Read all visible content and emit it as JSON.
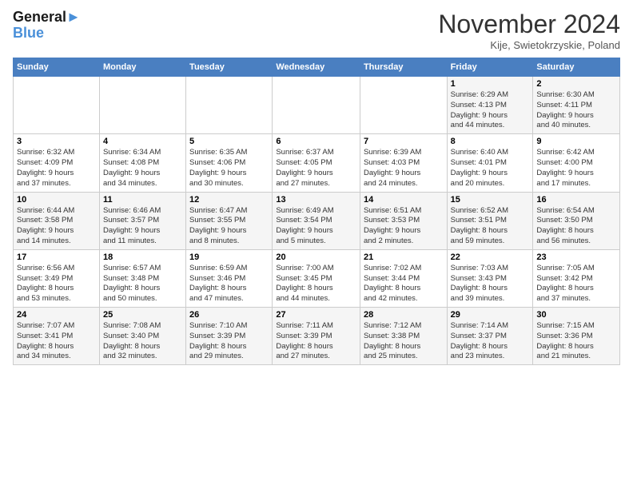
{
  "logo": {
    "line1": "General",
    "line2": "Blue"
  },
  "title": "November 2024",
  "location": "Kije, Swietokrzyskie, Poland",
  "days_of_week": [
    "Sunday",
    "Monday",
    "Tuesday",
    "Wednesday",
    "Thursday",
    "Friday",
    "Saturday"
  ],
  "weeks": [
    [
      {
        "day": "",
        "info": ""
      },
      {
        "day": "",
        "info": ""
      },
      {
        "day": "",
        "info": ""
      },
      {
        "day": "",
        "info": ""
      },
      {
        "day": "",
        "info": ""
      },
      {
        "day": "1",
        "info": "Sunrise: 6:29 AM\nSunset: 4:13 PM\nDaylight: 9 hours\nand 44 minutes."
      },
      {
        "day": "2",
        "info": "Sunrise: 6:30 AM\nSunset: 4:11 PM\nDaylight: 9 hours\nand 40 minutes."
      }
    ],
    [
      {
        "day": "3",
        "info": "Sunrise: 6:32 AM\nSunset: 4:09 PM\nDaylight: 9 hours\nand 37 minutes."
      },
      {
        "day": "4",
        "info": "Sunrise: 6:34 AM\nSunset: 4:08 PM\nDaylight: 9 hours\nand 34 minutes."
      },
      {
        "day": "5",
        "info": "Sunrise: 6:35 AM\nSunset: 4:06 PM\nDaylight: 9 hours\nand 30 minutes."
      },
      {
        "day": "6",
        "info": "Sunrise: 6:37 AM\nSunset: 4:05 PM\nDaylight: 9 hours\nand 27 minutes."
      },
      {
        "day": "7",
        "info": "Sunrise: 6:39 AM\nSunset: 4:03 PM\nDaylight: 9 hours\nand 24 minutes."
      },
      {
        "day": "8",
        "info": "Sunrise: 6:40 AM\nSunset: 4:01 PM\nDaylight: 9 hours\nand 20 minutes."
      },
      {
        "day": "9",
        "info": "Sunrise: 6:42 AM\nSunset: 4:00 PM\nDaylight: 9 hours\nand 17 minutes."
      }
    ],
    [
      {
        "day": "10",
        "info": "Sunrise: 6:44 AM\nSunset: 3:58 PM\nDaylight: 9 hours\nand 14 minutes."
      },
      {
        "day": "11",
        "info": "Sunrise: 6:46 AM\nSunset: 3:57 PM\nDaylight: 9 hours\nand 11 minutes."
      },
      {
        "day": "12",
        "info": "Sunrise: 6:47 AM\nSunset: 3:55 PM\nDaylight: 9 hours\nand 8 minutes."
      },
      {
        "day": "13",
        "info": "Sunrise: 6:49 AM\nSunset: 3:54 PM\nDaylight: 9 hours\nand 5 minutes."
      },
      {
        "day": "14",
        "info": "Sunrise: 6:51 AM\nSunset: 3:53 PM\nDaylight: 9 hours\nand 2 minutes."
      },
      {
        "day": "15",
        "info": "Sunrise: 6:52 AM\nSunset: 3:51 PM\nDaylight: 8 hours\nand 59 minutes."
      },
      {
        "day": "16",
        "info": "Sunrise: 6:54 AM\nSunset: 3:50 PM\nDaylight: 8 hours\nand 56 minutes."
      }
    ],
    [
      {
        "day": "17",
        "info": "Sunrise: 6:56 AM\nSunset: 3:49 PM\nDaylight: 8 hours\nand 53 minutes."
      },
      {
        "day": "18",
        "info": "Sunrise: 6:57 AM\nSunset: 3:48 PM\nDaylight: 8 hours\nand 50 minutes."
      },
      {
        "day": "19",
        "info": "Sunrise: 6:59 AM\nSunset: 3:46 PM\nDaylight: 8 hours\nand 47 minutes."
      },
      {
        "day": "20",
        "info": "Sunrise: 7:00 AM\nSunset: 3:45 PM\nDaylight: 8 hours\nand 44 minutes."
      },
      {
        "day": "21",
        "info": "Sunrise: 7:02 AM\nSunset: 3:44 PM\nDaylight: 8 hours\nand 42 minutes."
      },
      {
        "day": "22",
        "info": "Sunrise: 7:03 AM\nSunset: 3:43 PM\nDaylight: 8 hours\nand 39 minutes."
      },
      {
        "day": "23",
        "info": "Sunrise: 7:05 AM\nSunset: 3:42 PM\nDaylight: 8 hours\nand 37 minutes."
      }
    ],
    [
      {
        "day": "24",
        "info": "Sunrise: 7:07 AM\nSunset: 3:41 PM\nDaylight: 8 hours\nand 34 minutes."
      },
      {
        "day": "25",
        "info": "Sunrise: 7:08 AM\nSunset: 3:40 PM\nDaylight: 8 hours\nand 32 minutes."
      },
      {
        "day": "26",
        "info": "Sunrise: 7:10 AM\nSunset: 3:39 PM\nDaylight: 8 hours\nand 29 minutes."
      },
      {
        "day": "27",
        "info": "Sunrise: 7:11 AM\nSunset: 3:39 PM\nDaylight: 8 hours\nand 27 minutes."
      },
      {
        "day": "28",
        "info": "Sunrise: 7:12 AM\nSunset: 3:38 PM\nDaylight: 8 hours\nand 25 minutes."
      },
      {
        "day": "29",
        "info": "Sunrise: 7:14 AM\nSunset: 3:37 PM\nDaylight: 8 hours\nand 23 minutes."
      },
      {
        "day": "30",
        "info": "Sunrise: 7:15 AM\nSunset: 3:36 PM\nDaylight: 8 hours\nand 21 minutes."
      }
    ]
  ]
}
